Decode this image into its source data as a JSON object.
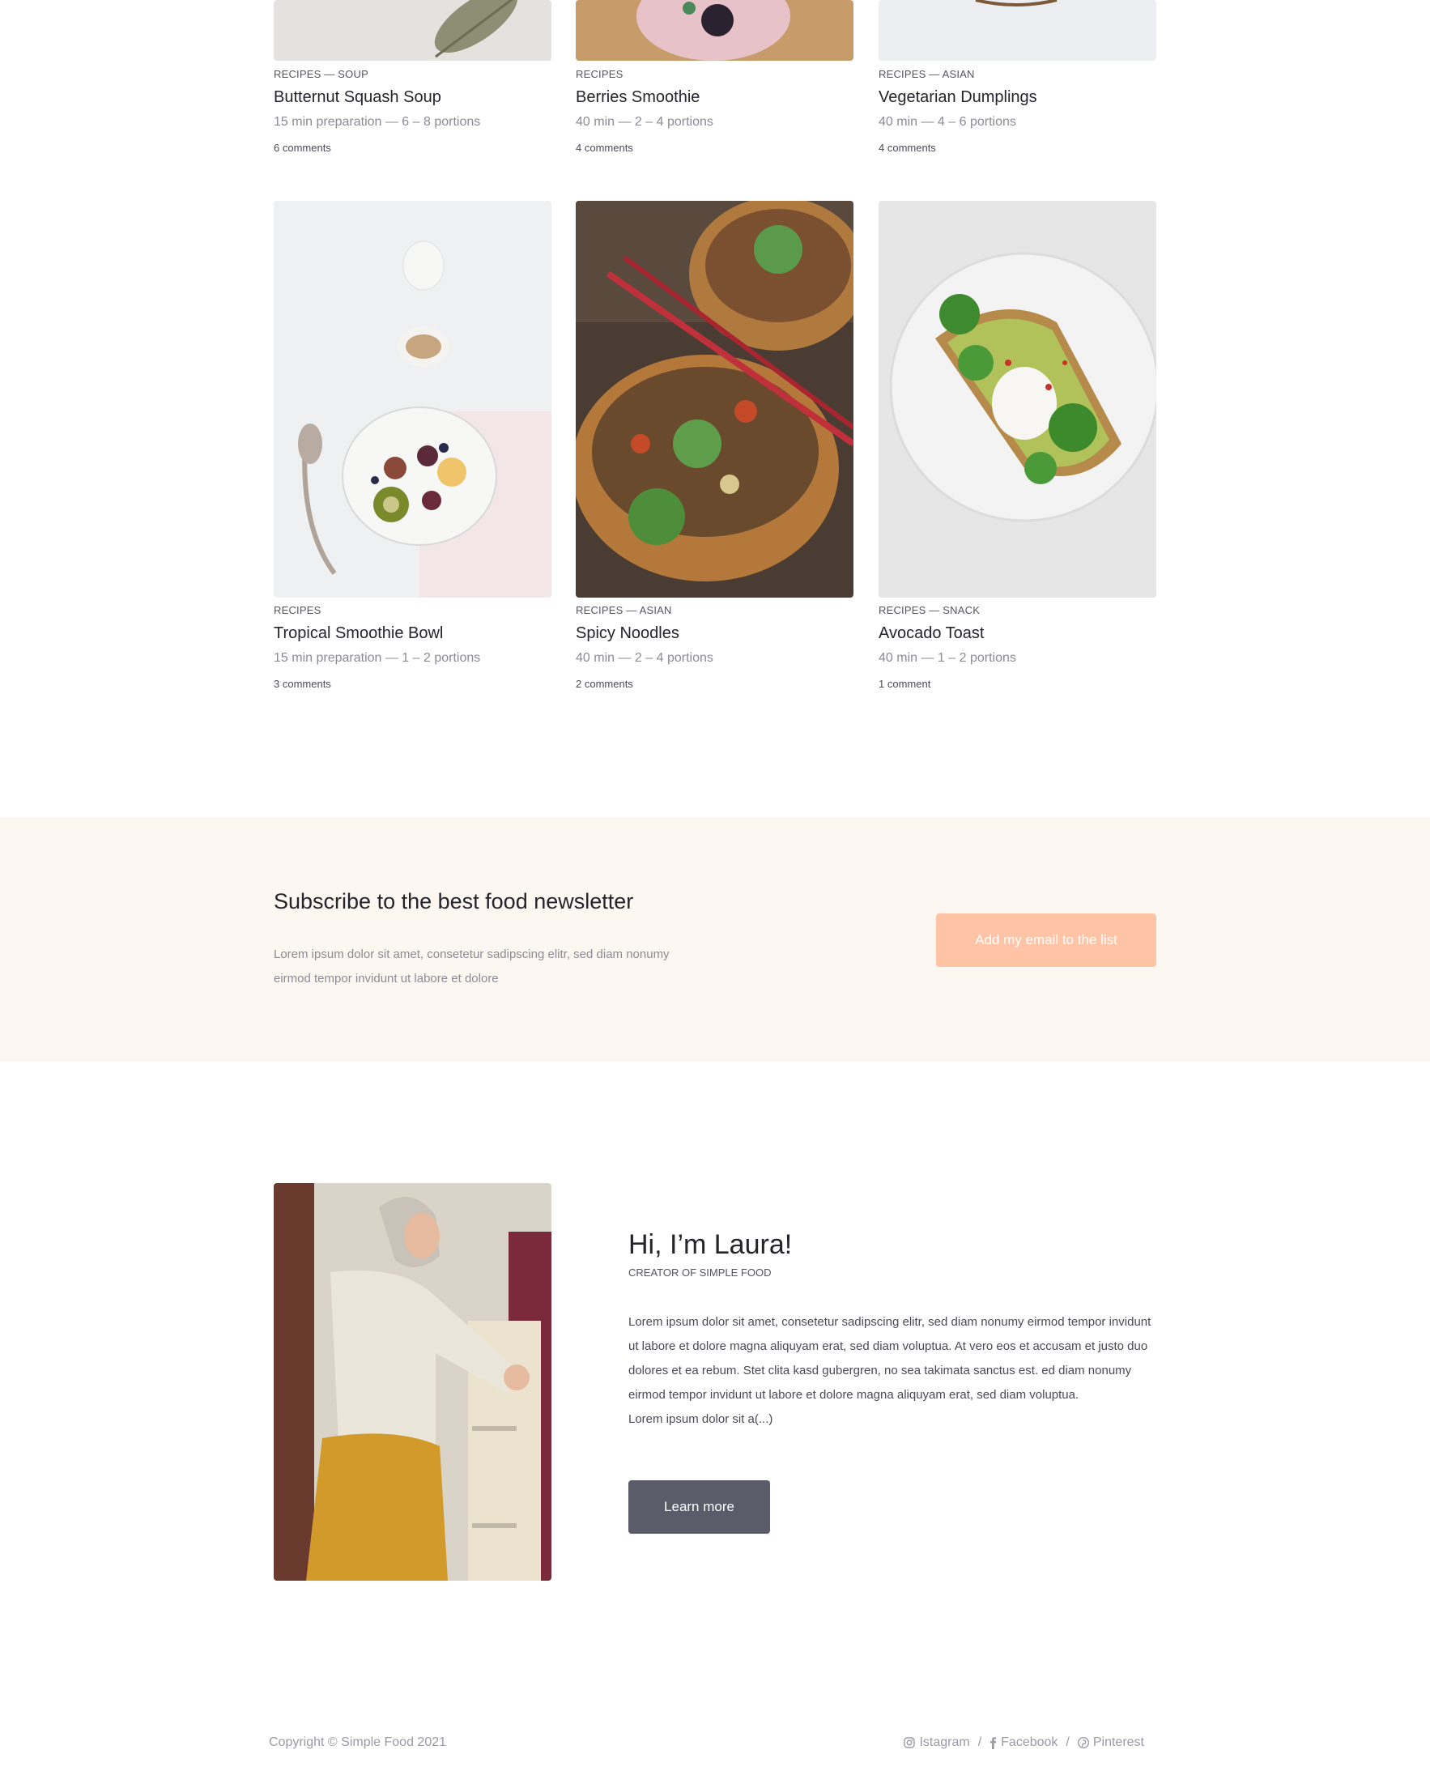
{
  "recipes_row1": [
    {
      "category": "RECIPES — SOUP",
      "title": "Butternut Squash Soup",
      "meta": "15 min preparation — 6 – 8 portions",
      "comments": "6 comments"
    },
    {
      "category": "RECIPES",
      "title": "Berries Smoothie",
      "meta": "40 min — 2 – 4 portions",
      "comments": "4 comments"
    },
    {
      "category": "RECIPES — ASIAN",
      "title": "Vegetarian Dumplings",
      "meta": "40 min — 4 – 6 portions",
      "comments": "4 comments"
    }
  ],
  "recipes_row2": [
    {
      "category": "RECIPES",
      "title": "Tropical Smoothie Bowl",
      "meta": "15 min preparation — 1 – 2 portions",
      "comments": "3 comments"
    },
    {
      "category": "RECIPES — ASIAN",
      "title": "Spicy Noodles",
      "meta": "40 min — 2 – 4 portions",
      "comments": "2 comments"
    },
    {
      "category": "RECIPES — SNACK",
      "title": "Avocado Toast",
      "meta": "40 min — 1 – 2 portions",
      "comments": "1 comment"
    }
  ],
  "newsletter": {
    "title": "Subscribe to the best food newsletter",
    "text": "Lorem ipsum dolor sit amet, consetetur sadipscing elitr, sed diam nonumy eirmod tempor invidunt ut labore et dolore",
    "button_label": "Add my email to the list"
  },
  "about": {
    "title": "Hi, I’m Laura!",
    "subtitle": "CREATOR OF SIMPLE FOOD",
    "paragraph": "Lorem ipsum dolor sit amet, consetetur sadipscing elitr, sed diam nonumy eirmod tempor invidunt ut labore et dolore magna aliquyam erat, sed diam voluptua. At vero eos et accusam et justo duo dolores et ea rebum. Stet clita kasd gubergren, no sea takimata sanctus est. ed diam nonumy eirmod tempor invidunt ut labore et dolore magna aliquyam erat, sed diam voluptua.",
    "paragraph_end": "Lorem ipsum dolor sit a(...)",
    "button_label": "Learn more"
  },
  "footer": {
    "copyright": "Copyright © Simple Food 2021",
    "social": [
      {
        "label": "Istagram",
        "icon": "instagram-icon"
      },
      {
        "label": "Facebook",
        "icon": "facebook-icon"
      },
      {
        "label": "Pinterest",
        "icon": "pinterest-icon"
      }
    ],
    "separator": "/"
  },
  "colors": {
    "newsletter_bg": "#fdf7f1",
    "newsletter_button": "#ffc4a5",
    "learn_button": "#5b5c6a"
  }
}
